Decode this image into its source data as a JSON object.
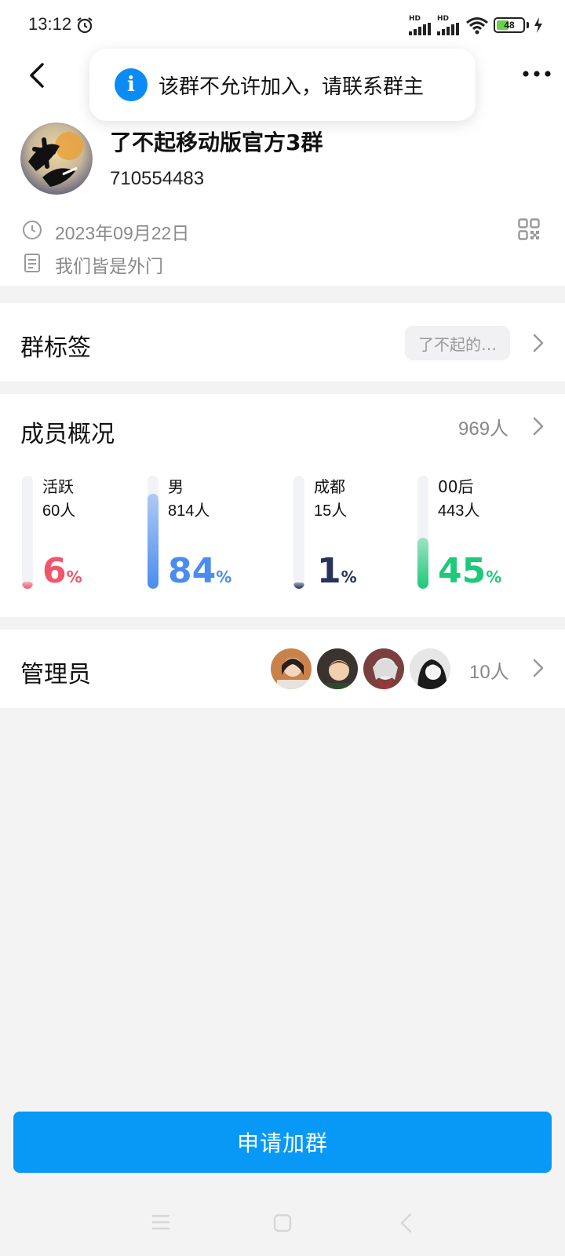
{
  "status_bar": {
    "time": "13:12",
    "signal_1_label": "HD",
    "signal_2_label": "HD",
    "battery_level": 48,
    "battery_text": "48"
  },
  "toast": {
    "icon": "info-icon",
    "icon_glyph": "i",
    "message": "该群不允许加入，请联系群主"
  },
  "group": {
    "name": "了不起移动版官方3群",
    "id": "710554483",
    "created": "2023年09月22日",
    "description": "我们皆是外门"
  },
  "tags": {
    "title": "群标签",
    "chip": "了不起的…"
  },
  "members": {
    "title": "成员概况",
    "count": "969人",
    "stats": [
      {
        "label": "活跃",
        "count": "60人",
        "value": "6",
        "unit": "%",
        "fraction": 0.06,
        "color": "#f2546a"
      },
      {
        "label": "男",
        "count": "814人",
        "value": "84",
        "unit": "%",
        "fraction": 0.84,
        "color": "#4a8cf0"
      },
      {
        "label": "成都",
        "count": "15人",
        "value": "1",
        "unit": "%",
        "fraction": 0.01,
        "color": "#26335a"
      },
      {
        "label": "00后",
        "count": "443人",
        "value": "45",
        "unit": "%",
        "fraction": 0.45,
        "color": "#1ec97a"
      }
    ]
  },
  "admins": {
    "title": "管理员",
    "count": "10人",
    "avatars": [
      "admin-avatar-1",
      "admin-avatar-2",
      "admin-avatar-3",
      "admin-avatar-4"
    ]
  },
  "join_button": "申请加群",
  "colors": {
    "accent": "#0899f7",
    "background": "#f3f3f3",
    "muted_text": "#8a8a8a"
  }
}
